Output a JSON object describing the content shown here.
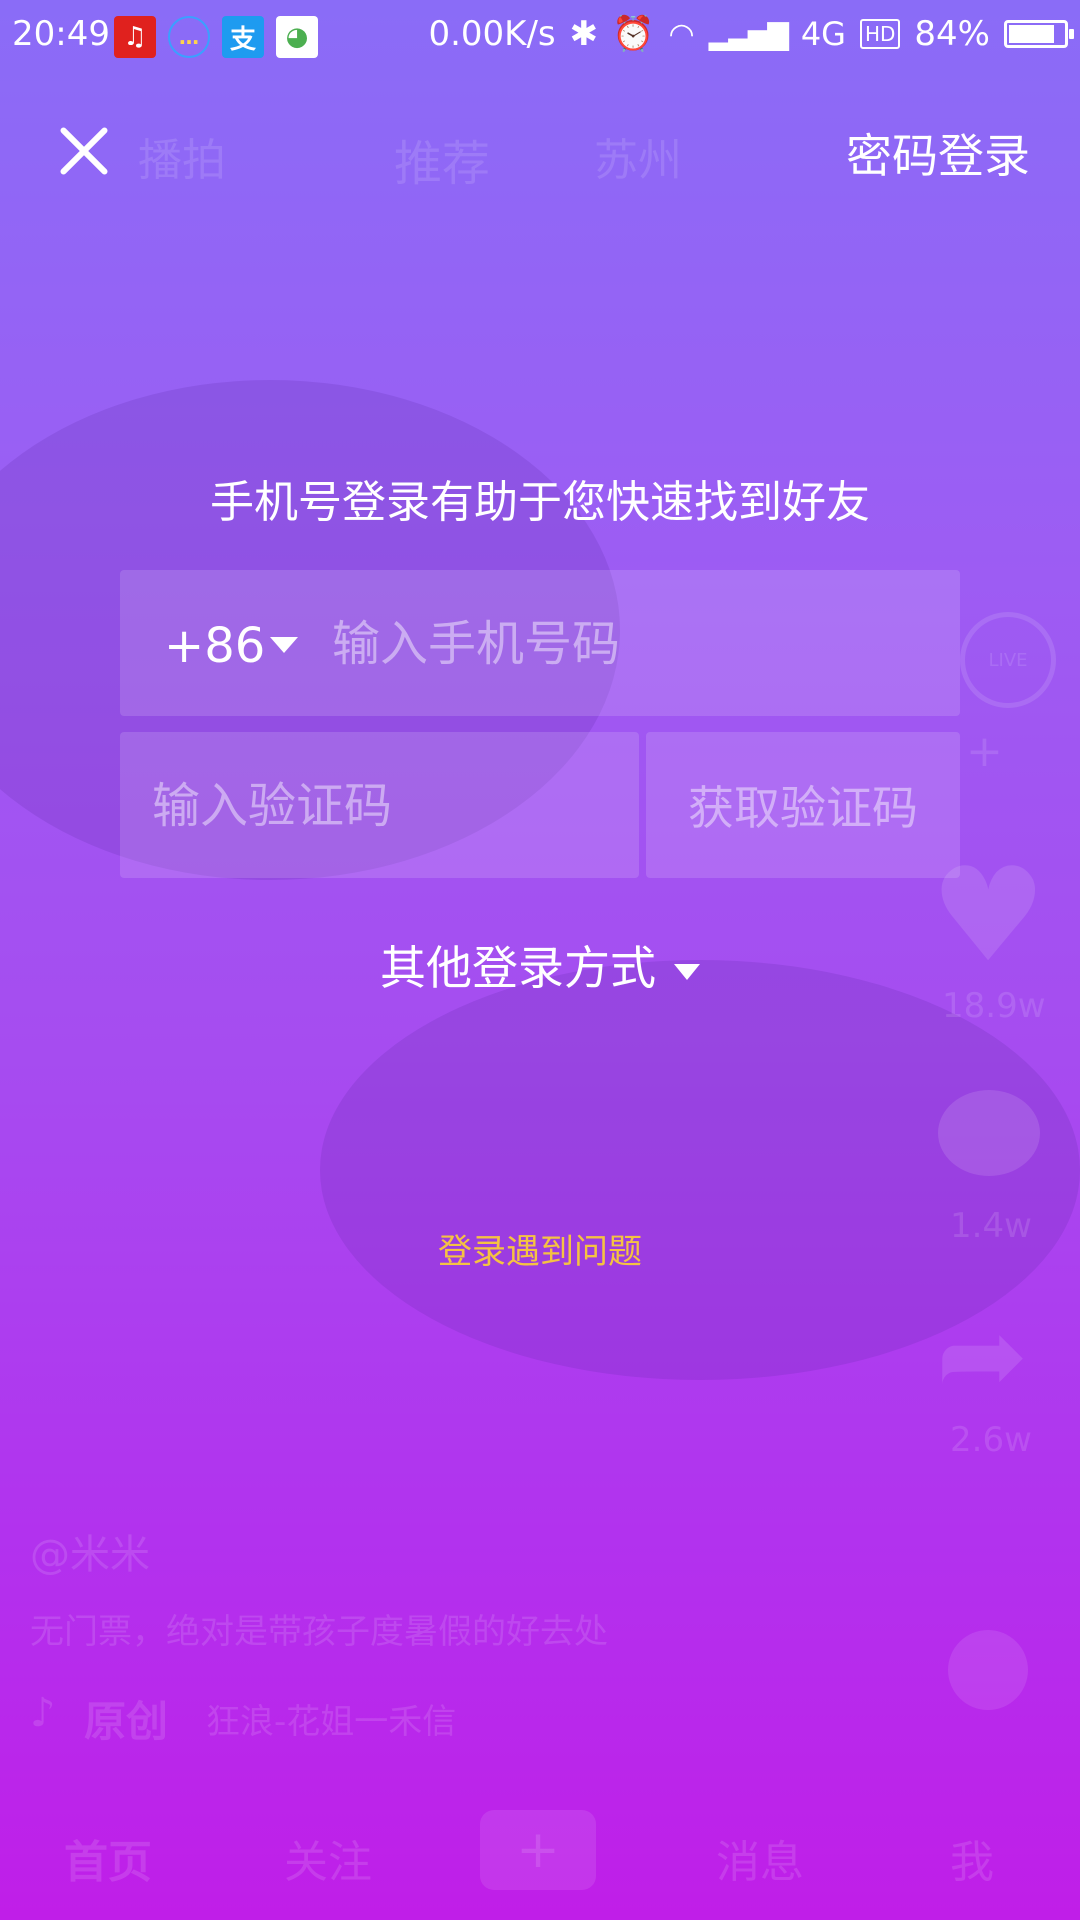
{
  "status_bar": {
    "time": "20:49",
    "net_speed": "0.00K/s",
    "network": "4G",
    "hd": "HD",
    "battery": "84%",
    "battery_level": 0.84,
    "apps": [
      "netease-music-icon",
      "qq-chat-icon",
      "alipay-icon",
      "app-icon"
    ]
  },
  "header": {
    "close_icon": "close-icon",
    "password_login": "密码登录"
  },
  "login": {
    "hint": "手机号登录有助于您快速找到好友",
    "country_code": "+86",
    "phone_placeholder": "输入手机号码",
    "code_placeholder": "输入验证码",
    "get_code": "获取验证码",
    "other_login": "其他登录方式",
    "trouble": "登录遇到问题"
  },
  "background_feed": {
    "tabs": [
      "播拍",
      "推荐",
      "苏州"
    ],
    "live_badge": "LIVE",
    "likes": "18.9w",
    "comments": "1.4w",
    "shares": "2.6w",
    "author": "@米米",
    "caption": "无门票，绝对是带孩子度暑假的好去处",
    "music_tag": "原创",
    "music_name": "狂浪-花姐一禾信",
    "bottom_nav": [
      "首页",
      "关注",
      "+",
      "消息",
      "我"
    ]
  },
  "colors": {
    "gradient_top": "#8a6cf7",
    "gradient_bottom": "#c01ee8",
    "trouble_link": "#f5c242"
  }
}
